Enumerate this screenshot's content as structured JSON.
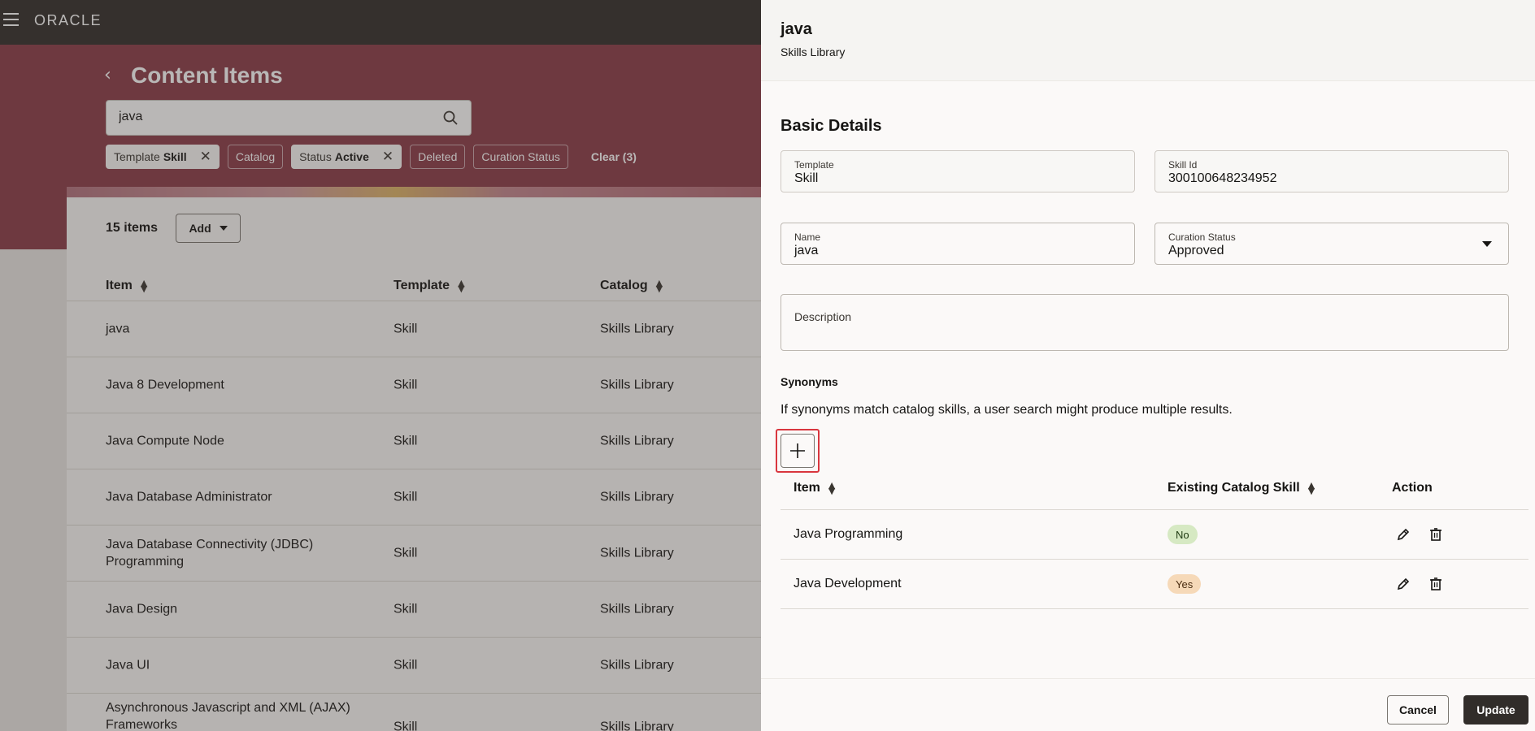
{
  "topbar": {
    "logo": "ORACLE"
  },
  "page": {
    "title": "Content Items",
    "search_value": "java",
    "chips": [
      {
        "prefix": "Template",
        "value": "Skill"
      },
      {
        "label": "Catalog"
      },
      {
        "prefix": "Status",
        "value": "Active"
      },
      {
        "label": "Deleted"
      },
      {
        "label": "Curation Status"
      }
    ],
    "clear_label": "Clear (3)",
    "count": "15 items",
    "add_label": "Add",
    "columns": {
      "item": "Item",
      "template": "Template",
      "catalog": "Catalog"
    },
    "rows": [
      {
        "item": "java",
        "template": "Skill",
        "catalog": "Skills Library"
      },
      {
        "item": "Java 8 Development",
        "template": "Skill",
        "catalog": "Skills Library"
      },
      {
        "item": "Java Compute Node",
        "template": "Skill",
        "catalog": "Skills Library"
      },
      {
        "item": "Java Database Administrator",
        "template": "Skill",
        "catalog": "Skills Library"
      },
      {
        "item": "Java Database Connectivity (JDBC) Programming",
        "template": "Skill",
        "catalog": "Skills Library"
      },
      {
        "item": "Java Design",
        "template": "Skill",
        "catalog": "Skills Library"
      },
      {
        "item": "Java UI",
        "template": "Skill",
        "catalog": "Skills Library"
      },
      {
        "item": "Asynchronous Javascript and XML (AJAX) Frameworks",
        "template": "Skill",
        "catalog": "Skills Library"
      }
    ]
  },
  "drawer": {
    "title": "java",
    "subtitle": "Skills Library",
    "section": "Basic Details",
    "template_label": "Template",
    "template_value": "Skill",
    "skill_id_label": "Skill Id",
    "skill_id_value": "300100648234952",
    "name_label": "Name",
    "name_value": "java",
    "curation_label": "Curation Status",
    "curation_value": "Approved",
    "description_label": "Description",
    "synonyms_title": "Synonyms",
    "synonyms_help": "If synonyms match catalog skills, a user search might produce multiple results.",
    "syn_columns": {
      "item": "Item",
      "existing": "Existing Catalog Skill",
      "action": "Action"
    },
    "synonyms": [
      {
        "item": "Java Programming",
        "existing": "No"
      },
      {
        "item": "Java Development",
        "existing": "Yes"
      }
    ],
    "cancel_label": "Cancel",
    "update_label": "Update"
  },
  "colors": {
    "topbar": "#312d2a",
    "hero": "#8a3b47",
    "highlight": "#d9363e",
    "badge_no": "#d6e9c3",
    "badge_yes": "#f6d9b8",
    "primary_button": "#312d2a"
  }
}
